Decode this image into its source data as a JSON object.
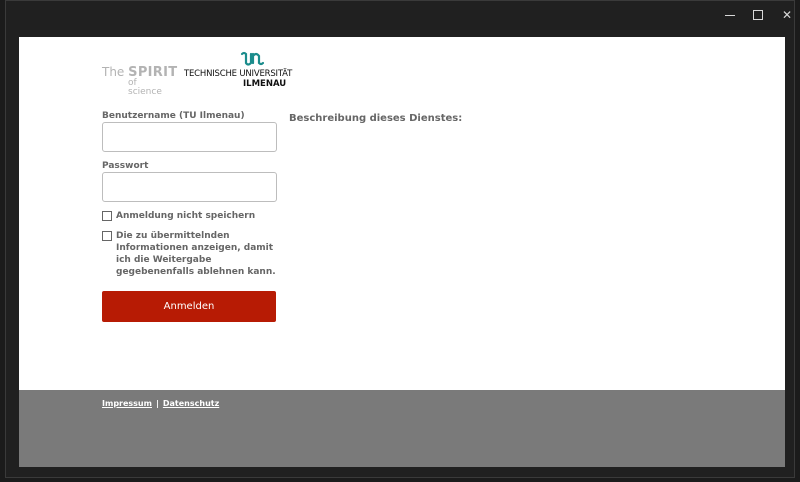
{
  "logos": {
    "spirit_the": "The",
    "spirit_word": "SPIRIT",
    "spirit_of": "of science",
    "tu_line1": "TECHNISCHE UNIVERSITÄT",
    "tu_line2": "ILMENAU"
  },
  "form": {
    "username_label": "Benutzername (TU Ilmenau)",
    "username_value": "",
    "password_label": "Passwort",
    "password_value": "",
    "dont_save_label": "Anmeldung nicht speichern",
    "show_info_label": "Die zu übermittelnden Informationen anzeigen, damit ich die Weitergabe gegebenenfalls ablehnen kann.",
    "login_button": "Anmelden"
  },
  "service": {
    "description_heading": "Beschreibung dieses Dienstes:"
  },
  "footer": {
    "impressum": "Impressum",
    "separator": "|",
    "datenschutz": "Datenschutz"
  },
  "colors": {
    "accent": "#b71b04",
    "footer_bg": "#7a7a7a",
    "tu_teal": "#1b8c8c"
  }
}
